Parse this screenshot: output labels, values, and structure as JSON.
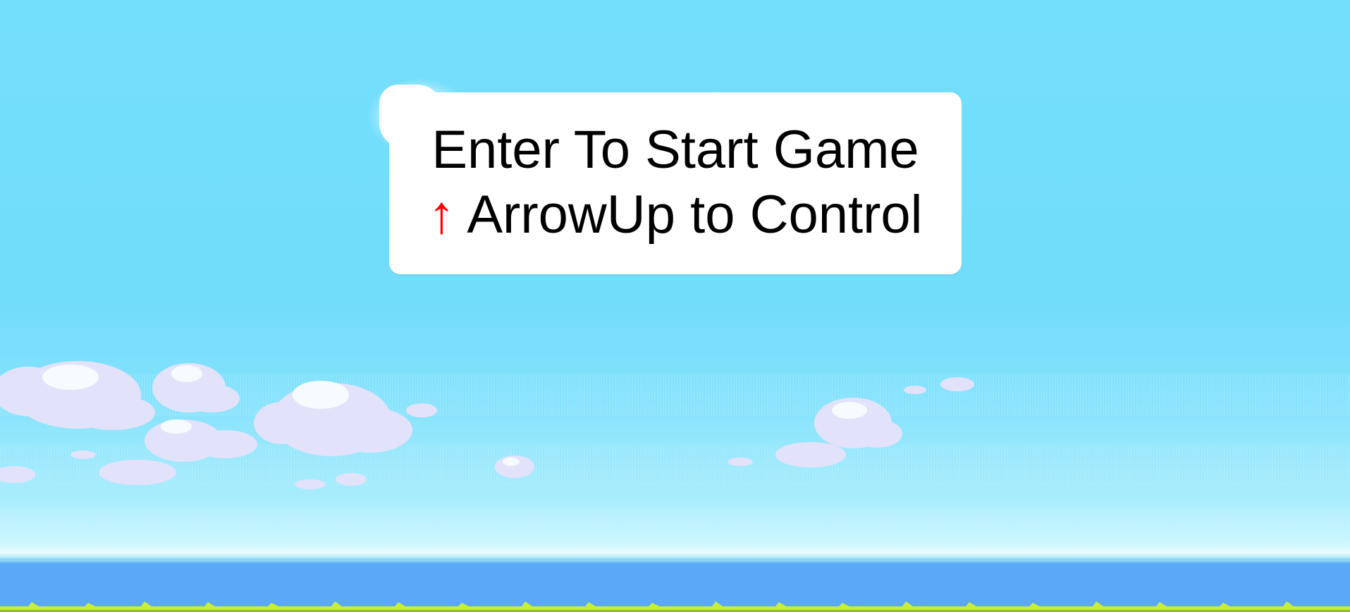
{
  "start_panel": {
    "line1": "Enter To Start Game",
    "arrow_glyph": "↑",
    "line2_text": " ArrowUp to Control"
  },
  "colors": {
    "sky_top": "#74dffc",
    "sky_horizon": "#c9f6ff",
    "water": "#5aa8f6",
    "grass": "#c8ee3a",
    "cloud": "#e3e2fb",
    "cloud_highlight": "#f6fbff",
    "arrow": "#ff0000",
    "panel": "#ffffff"
  },
  "icons": {
    "control_key": "arrow-up-icon"
  }
}
